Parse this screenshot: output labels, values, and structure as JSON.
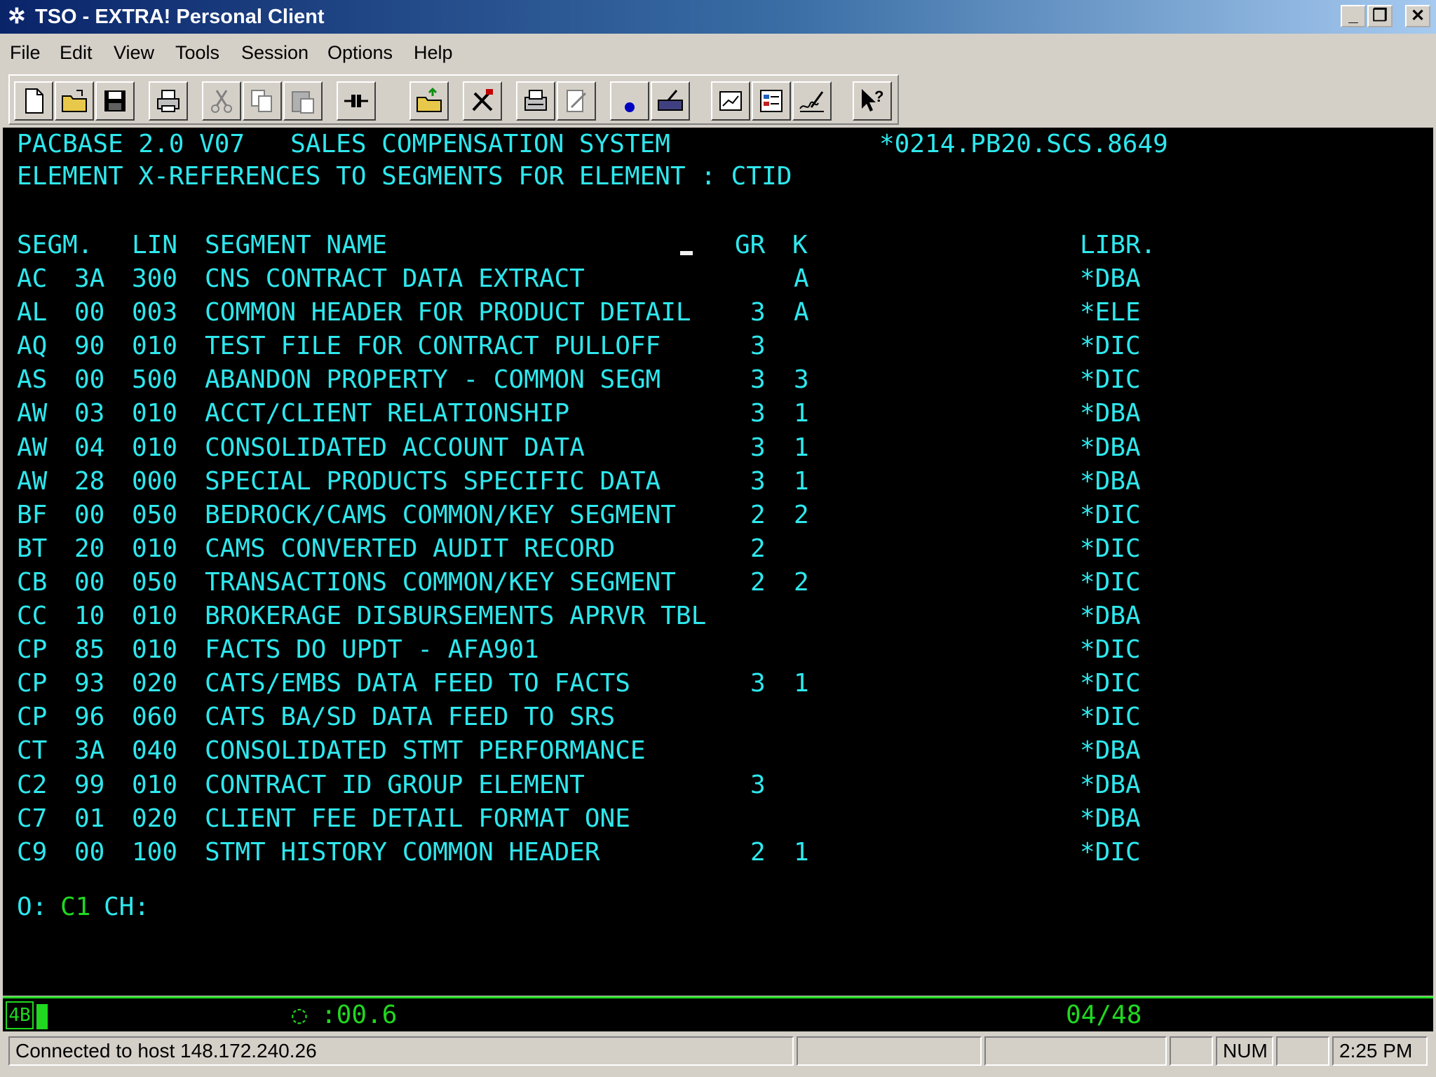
{
  "window": {
    "title": "TSO - EXTRA! Personal Client",
    "icon": "gear-cluster-icon",
    "controls": {
      "minimize": "_",
      "maximize": "❐",
      "close": "✕"
    }
  },
  "menu": [
    {
      "label": "File",
      "icon": "none"
    },
    {
      "label": "Edit"
    },
    {
      "label": "View"
    },
    {
      "label": "Tools"
    },
    {
      "label": "Session"
    },
    {
      "label": "Options"
    },
    {
      "label": "Help"
    }
  ],
  "toolbar": [
    "new-document-icon",
    "open-folder-icon",
    "save-disk-icon",
    "print-icon",
    "cut-icon",
    "copy-icon",
    "paste-icon",
    "connect-icon",
    "file-transfer-icon",
    "tools-icon",
    "fax-icon",
    "edit-page-icon",
    "record-dot-icon",
    "keyboard-map-icon",
    "chart-edit-icon",
    "form-edit-icon",
    "signature-icon",
    "help-pointer-icon"
  ],
  "terminal": {
    "header_left": "PACBASE 2.0 V07   SALES COMPENSATION SYSTEM",
    "header_right": "*0214.PB20.SCS.8649",
    "subtitle": "ELEMENT X-REFERENCES TO SEGMENTS FOR ELEMENT : CTID",
    "columns": {
      "segm": "SEGM.",
      "lin": "LIN",
      "name": "SEGMENT NAME",
      "gr": "GR",
      "k": "K",
      "libr": "LIBR."
    },
    "rows": [
      {
        "seg": "AC",
        "num": "3A",
        "lin": "300",
        "name": "CNS CONTRACT DATA EXTRACT",
        "gr": "",
        "k": "A",
        "libr": "*DBA"
      },
      {
        "seg": "AL",
        "num": "00",
        "lin": "003",
        "name": "COMMON HEADER FOR PRODUCT DETAIL",
        "gr": "3",
        "k": "A",
        "libr": "*ELE"
      },
      {
        "seg": "AQ",
        "num": "90",
        "lin": "010",
        "name": "TEST FILE FOR CONTRACT PULLOFF",
        "gr": "3",
        "k": "",
        "libr": "*DIC"
      },
      {
        "seg": "AS",
        "num": "00",
        "lin": "500",
        "name": "ABANDON PROPERTY - COMMON SEGM",
        "gr": "3",
        "k": "3",
        "libr": "*DIC"
      },
      {
        "seg": "AW",
        "num": "03",
        "lin": "010",
        "name": "ACCT/CLIENT RELATIONSHIP",
        "gr": "3",
        "k": "1",
        "libr": "*DBA"
      },
      {
        "seg": "AW",
        "num": "04",
        "lin": "010",
        "name": "CONSOLIDATED ACCOUNT DATA",
        "gr": "3",
        "k": "1",
        "libr": "*DBA"
      },
      {
        "seg": "AW",
        "num": "28",
        "lin": "000",
        "name": "SPECIAL PRODUCTS SPECIFIC DATA",
        "gr": "3",
        "k": "1",
        "libr": "*DBA"
      },
      {
        "seg": "BF",
        "num": "00",
        "lin": "050",
        "name": "BEDROCK/CAMS COMMON/KEY SEGMENT",
        "gr": "2",
        "k": "2",
        "libr": "*DIC"
      },
      {
        "seg": "BT",
        "num": "20",
        "lin": "010",
        "name": "CAMS CONVERTED AUDIT RECORD",
        "gr": "2",
        "k": "",
        "libr": "*DIC"
      },
      {
        "seg": "CB",
        "num": "00",
        "lin": "050",
        "name": "TRANSACTIONS COMMON/KEY SEGMENT",
        "gr": "2",
        "k": "2",
        "libr": "*DIC"
      },
      {
        "seg": "CC",
        "num": "10",
        "lin": "010",
        "name": "BROKERAGE DISBURSEMENTS APRVR TBL",
        "gr": "",
        "k": "",
        "libr": "*DBA"
      },
      {
        "seg": "CP",
        "num": "85",
        "lin": "010",
        "name": "FACTS DO UPDT - AFA901",
        "gr": "",
        "k": "",
        "libr": "*DIC"
      },
      {
        "seg": "CP",
        "num": "93",
        "lin": "020",
        "name": "CATS/EMBS DATA FEED TO FACTS",
        "gr": "3",
        "k": "1",
        "libr": "*DIC"
      },
      {
        "seg": "CP",
        "num": "96",
        "lin": "060",
        "name": "CATS BA/SD DATA FEED TO SRS",
        "gr": "",
        "k": "",
        "libr": "*DIC"
      },
      {
        "seg": "CT",
        "num": "3A",
        "lin": "040",
        "name": "CONSOLIDATED STMT PERFORMANCE",
        "gr": "",
        "k": "",
        "libr": "*DBA"
      },
      {
        "seg": "C2",
        "num": "99",
        "lin": "010",
        "name": "CONTRACT ID GROUP ELEMENT",
        "gr": "3",
        "k": "",
        "libr": "*DBA"
      },
      {
        "seg": "C7",
        "num": "01",
        "lin": "020",
        "name": "CLIENT FEE DETAIL FORMAT ONE",
        "gr": "",
        "k": "",
        "libr": "*DBA"
      },
      {
        "seg": "C9",
        "num": "00",
        "lin": "100",
        "name": "STMT HISTORY COMMON HEADER",
        "gr": "2",
        "k": "1",
        "libr": "*DIC"
      }
    ],
    "command_prefix": "O:",
    "command_value": "C1",
    "command_suffix": "CH:"
  },
  "oia": {
    "session_indicator": "4B",
    "timer": ":00.6",
    "cursor_position": "04/48"
  },
  "statusbar": {
    "connection": "Connected to host 148.172.240.26",
    "num": "NUM",
    "time": "2:25 PM"
  },
  "colors": {
    "terminal_text": "#2ee8ee",
    "terminal_green": "#20d820",
    "terminal_bg": "#000000"
  }
}
